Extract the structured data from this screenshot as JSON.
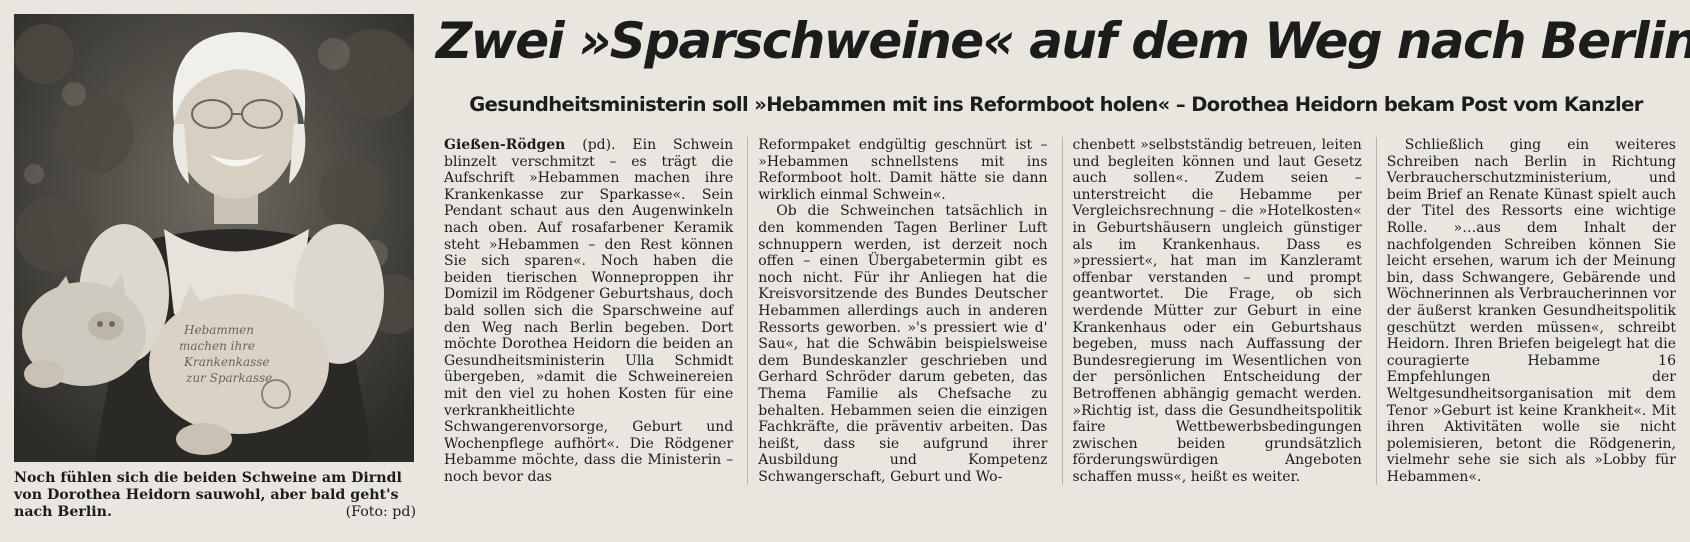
{
  "headline": "Zwei »Sparschweine« auf dem Weg nach Berlin",
  "subheadline": "Gesundheitsministerin soll »Hebammen mit ins Reformboot holen« – Dorothea Heidorn bekam Post vom Kanzler",
  "photo": {
    "caption": "Noch fühlen sich die beiden Schweine am Dirndl von Dorothea Heidorn sauwohl, aber bald geht's nach Berlin.",
    "credit": "(Foto: pd)",
    "pig_text": [
      "Hebammen",
      "machen ihre",
      "Krankenkasse",
      "zur Sparkasse"
    ]
  },
  "article": {
    "dateline": "Gießen-Rödgen",
    "columns": [
      [
        "(pd). Ein Schwein blinzelt verschmitzt – es trägt die Aufschrift »Hebammen machen ihre Krankenkasse zur Sparkasse«. Sein Pendant schaut aus den Augenwinkeln nach oben. Auf rosafarbener Keramik steht »Hebammen – den Rest können Sie sich sparen«. Noch haben die beiden tierischen Wonneproppen ihr Domizil im Rödgener Geburtshaus, doch bald sollen sich die Sparschweine auf den Weg nach Berlin begeben. Dort möchte Dorothea Heidorn die beiden an Gesundheitsministerin Ulla Schmidt übergeben, »damit die Schweinereien mit den viel zu hohen Kosten für eine verkrankheitlichte Schwangerenvorsorge, Geburt und Wochenpflege aufhört«. Die Rödgener Hebamme möchte, dass die Ministerin – noch bevor das"
      ],
      [
        "Reformpaket endgültig geschnürt ist – »Hebammen schnellstens mit ins Reformboot holt. Damit hätte sie dann wirklich einmal Schwein«.",
        "Ob die Schweinchen tatsächlich in den kommenden Tagen Berliner Luft schnuppern werden, ist derzeit noch offen – einen Übergabetermin gibt es noch nicht. Für ihr Anliegen hat die Kreisvorsitzende des Bundes Deutscher Hebammen allerdings auch in anderen Ressorts geworben. »'s pressiert wie d' Sau«, hat die Schwäbin beispielsweise dem Bundeskanzler geschrieben und Gerhard Schröder darum gebeten, das Thema Familie als Chefsache zu behalten. Hebammen seien die einzigen Fachkräfte, die präventiv arbeiten. Das heißt, dass sie aufgrund ihrer Ausbildung und Kompetenz Schwangerschaft, Geburt und Wo-"
      ],
      [
        "chenbett »selbstständig betreuen, leiten und begleiten können und laut Gesetz auch sollen«. Zudem seien – unterstreicht die Hebamme per Vergleichsrechnung – die »Hotelkosten« in Geburtshäusern ungleich günstiger als im Krankenhaus. Dass es »pressiert«, hat man im Kanzleramt offenbar verstanden – und prompt geantwortet. Die Frage, ob sich werdende Mütter zur Geburt in eine Krankenhaus oder ein Geburtshaus begeben, muss nach Auffassung der Bundesregierung im Wesentlichen von der persönlichen Entscheidung der Betroffenen abhängig gemacht werden. »Richtig ist, dass die Gesundheitspolitik faire Wettbewerbsbedingungen zwischen beiden grundsätzlich förderungswürdigen Angeboten schaffen muss«, heißt es weiter."
      ],
      [
        "Schließlich ging ein weiteres Schreiben nach Berlin in Richtung Verbraucherschutzministerium, und beim Brief an Renate Künast spielt auch der Titel des Ressorts eine wichtige Rolle. »…aus dem Inhalt der nachfolgenden Schreiben können Sie leicht ersehen, warum ich der Meinung bin, dass Schwangere, Gebärende und Wöchnerinnen als Verbraucherinnen vor der äußerst kranken Gesundheitspolitik geschützt werden müssen«, schreibt Heidorn. Ihren Briefen beigelegt hat die couragierte Hebamme 16 Empfehlungen der Weltgesundheitsorganisation mit dem Tenor »Geburt ist keine Krankheit«. Mit ihren Aktivitäten wolle sie nicht polemisieren, betont die Rödgenerin, vielmehr sehe sie sich als »Lobby für Hebammen«."
      ]
    ]
  }
}
